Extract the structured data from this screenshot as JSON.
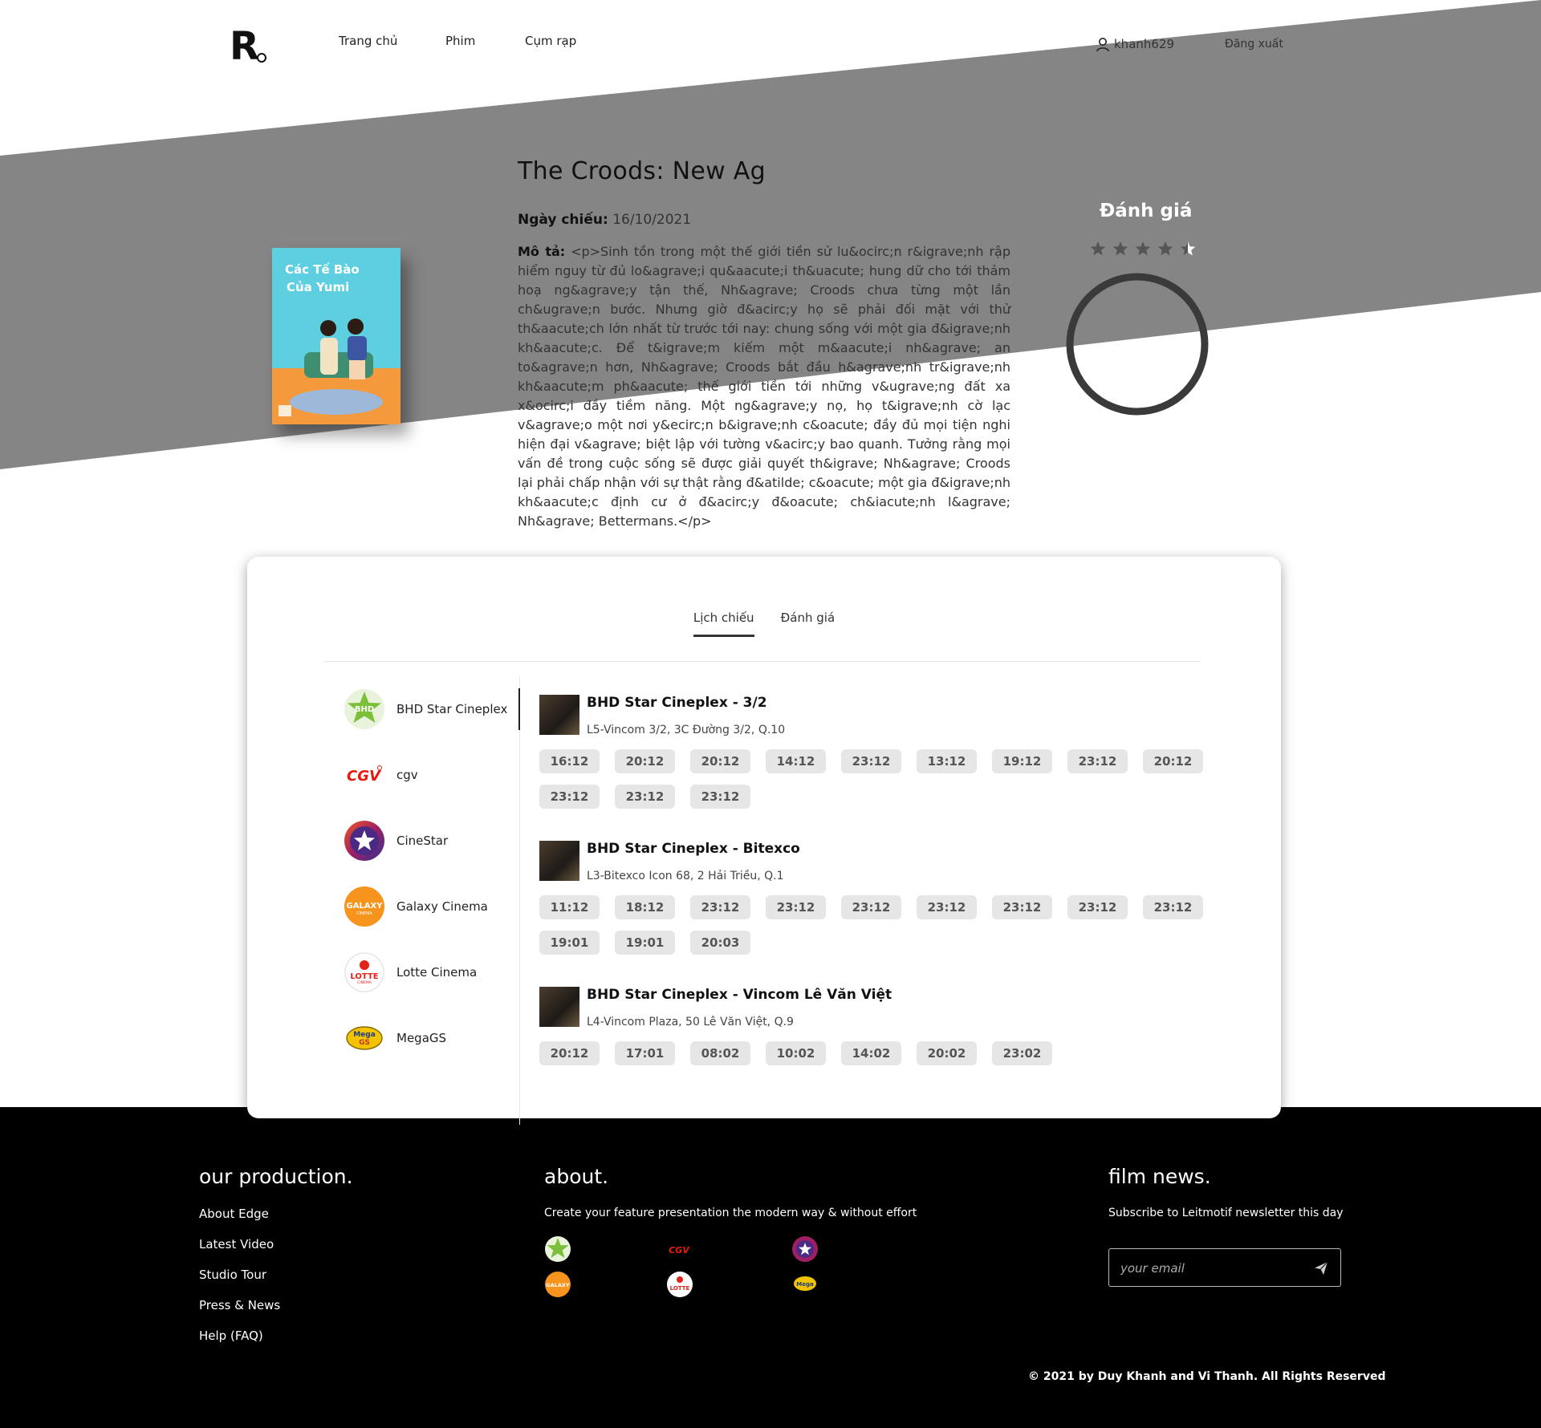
{
  "header": {
    "logo": "R",
    "nav": {
      "home": "Trang chủ",
      "films": "Phim",
      "cinemas": "Cụm rạp"
    },
    "username": "khanh629",
    "logout": "Đăng xuất"
  },
  "movie": {
    "title": "The Croods: New Ag",
    "release_label": "Ngày chiếu:",
    "release_date": "16/10/2021",
    "desc_label": "Mô tả:",
    "description": "<p>Sinh tồn trong một thế giới tiền sử lu&ocirc;n r&igrave;nh rập hiểm nguy từ đủ lo&agrave;i qu&aacute;i th&uacute; hung dữ cho tới thảm hoạ ng&agrave;y tận thế, Nh&agrave; Croods chưa từng một lần ch&ugrave;n bước. Nhưng giờ đ&acirc;y họ sẽ phải đối mặt với thử th&aacute;ch lớn nhất từ trước tới nay: chung sống với một gia đ&igrave;nh kh&aacute;c. Để t&igrave;m kiếm một m&aacute;i nh&agrave; an to&agrave;n hơn, Nh&agrave; Croods bắt đầu h&agrave;nh tr&igrave;nh kh&aacute;m ph&aacute; thế giới tiền tới những v&ugrave;ng đất xa x&ocirc;i đầy tiềm năng. Một ng&agrave;y nọ, họ t&igrave;nh cờ lạc v&agrave;o một nơi y&ecirc;n b&igrave;nh c&oacute; đầy đủ mọi tiện nghi hiện đại v&agrave; biệt lập với tường v&acirc;y bao quanh. Tưởng rằng mọi vấn đề trong cuộc sống sẽ được giải quyết th&igrave; Nh&agrave; Croods lại phải chấp nhận với sự thật rằng đ&atilde; c&oacute; một gia đ&igrave;nh kh&aacute;c định cư ở đ&acirc;y đ&oacute; ch&iacute;nh l&agrave; Nh&agrave; Bettermans.</p>",
    "poster_title_line1": "Các Tế Bào",
    "poster_title_line2": "Của Yumi",
    "rating_title": "Đánh giá",
    "rating_stars": 4.5,
    "rating_max": 5
  },
  "tabs": {
    "schedule": "Lịch chiếu",
    "reviews": "Đánh giá"
  },
  "brands": [
    {
      "name": "BHD Star Cineplex",
      "logo": "bhd-logo",
      "color": "#7bbf3a"
    },
    {
      "name": "cgv",
      "logo": "cgv-logo",
      "color": "#e71a0f"
    },
    {
      "name": "CineStar",
      "logo": "cinestar-logo",
      "color": "#6a2c91"
    },
    {
      "name": "Galaxy Cinema",
      "logo": "galaxy-logo",
      "color": "#f7941d"
    },
    {
      "name": "Lotte Cinema",
      "logo": "lotte-logo",
      "color": "#e2231a"
    },
    {
      "name": "MegaGS",
      "logo": "megags-logo",
      "color": "#f2c300"
    }
  ],
  "theaters": [
    {
      "name": "BHD Star Cineplex - 3/2",
      "address": "L5-Vincom 3/2, 3C Đường 3/2, Q.10",
      "times": [
        "16:12",
        "20:12",
        "20:12",
        "14:12",
        "23:12",
        "13:12",
        "19:12",
        "23:12",
        "20:12",
        "23:12",
        "23:12",
        "23:12"
      ]
    },
    {
      "name": "BHD Star Cineplex - Bitexco",
      "address": "L3-Bitexco Icon 68, 2 Hải Triều, Q.1",
      "times": [
        "11:12",
        "18:12",
        "23:12",
        "23:12",
        "23:12",
        "23:12",
        "23:12",
        "23:12",
        "23:12",
        "19:01",
        "19:01",
        "20:03"
      ]
    },
    {
      "name": "BHD Star Cineplex - Vincom Lê Văn Việt",
      "address": "L4-Vincom Plaza, 50 Lê Văn Việt, Q.9",
      "times": [
        "20:12",
        "17:01",
        "08:02",
        "10:02",
        "14:02",
        "20:02",
        "23:02"
      ]
    }
  ],
  "footer": {
    "production_title": "our production.",
    "links": [
      "About Edge",
      "Latest Video",
      "Studio Tour",
      "Press & News",
      "Help (FAQ)"
    ],
    "about_title": "about.",
    "about_text": "Create your feature presentation the modern way & without effort",
    "news_title": "film news.",
    "news_text": "Subscribe to Leitmotif newsletter this day",
    "email_placeholder": "your email",
    "copyright": "© 2021 by Duy Khanh and Vi Thanh. All Rights Reserved"
  },
  "colors": {
    "band": "#858585",
    "footer_bg": "#000000",
    "chip_bg": "#e6e6e6",
    "gauge_ring": "#3a3a3a"
  }
}
